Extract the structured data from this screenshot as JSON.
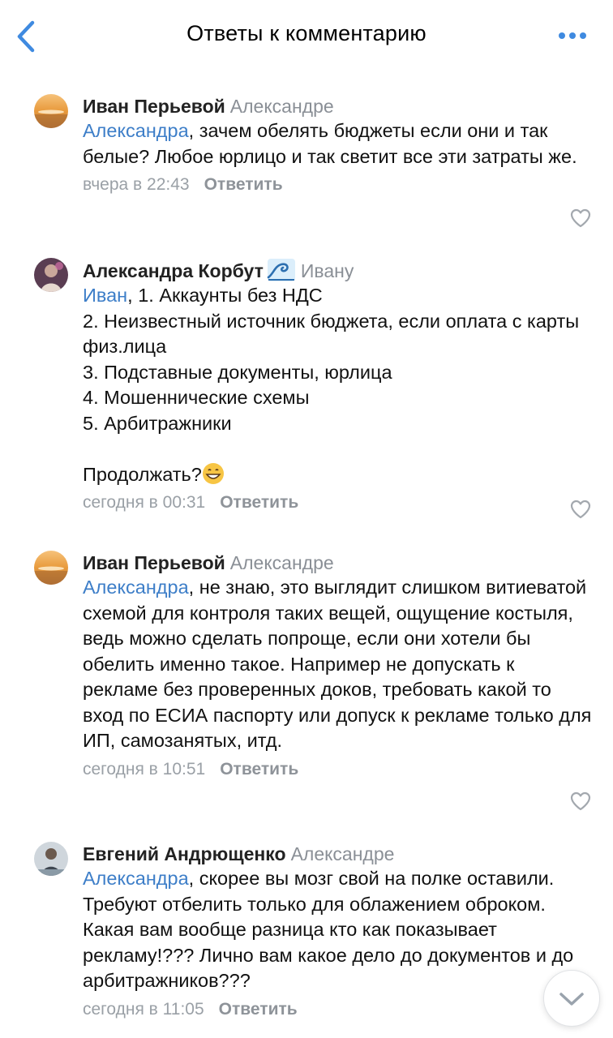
{
  "header": {
    "title": "Ответы к комментарию"
  },
  "comments": [
    {
      "author": "Иван Перьевой",
      "reply_to": "Александре",
      "mention": "Александра",
      "text": ", зачем обелять бюджеты если они и так белые? Любое юрлицо и так светит все эти затраты же.",
      "time": "вчера в 22:43",
      "reply_label": "Ответить"
    },
    {
      "author": "Александра Корбут",
      "reply_to": "Ивану",
      "mention": "Иван",
      "text": ", 1. Аккаунты без НДС\n2. Неизвестный источник бюджета, если оплата с карты физ.лица\n3. Подставные документы, юрлица\n4. Мошеннические схемы\n5. Арбитражники\n\nПродолжать?",
      "time": "сегодня в 00:31",
      "reply_label": "Ответить"
    },
    {
      "author": "Иван Перьевой",
      "reply_to": "Александре",
      "mention": "Александра",
      "text": ", не знаю, это выглядит слишком витиеватой схемой для контроля таких вещей, ощущение костыля, ведь можно сделать попроще, если они хотели бы обелить именно такое. Например не допускать к рекламе без проверенных доков, требовать какой то вход по ЕСИА паспорту или допуск к рекламе только для ИП, самозанятых, итд.",
      "time": "сегодня в 10:51",
      "reply_label": "Ответить"
    },
    {
      "author": "Евгений Андрющенко",
      "reply_to": "Александре",
      "mention": "Александра",
      "text": ", скорее вы мозг свой на полке оставили. Требуют отбелить только для облажением оброком. Какая вам вообще разница кто как показывает рекламу!??? Лично вам какое дело до документов и до арбитражников???",
      "time": "сегодня в 11:05",
      "reply_label": "Ответить"
    }
  ],
  "icons": {
    "back": "chevron-left-icon",
    "more": "more-dots-icon",
    "like": "heart-icon",
    "scroll": "chevron-down-icon"
  },
  "colors": {
    "accent": "#3d7ec8",
    "muted": "#9aa0a6"
  }
}
